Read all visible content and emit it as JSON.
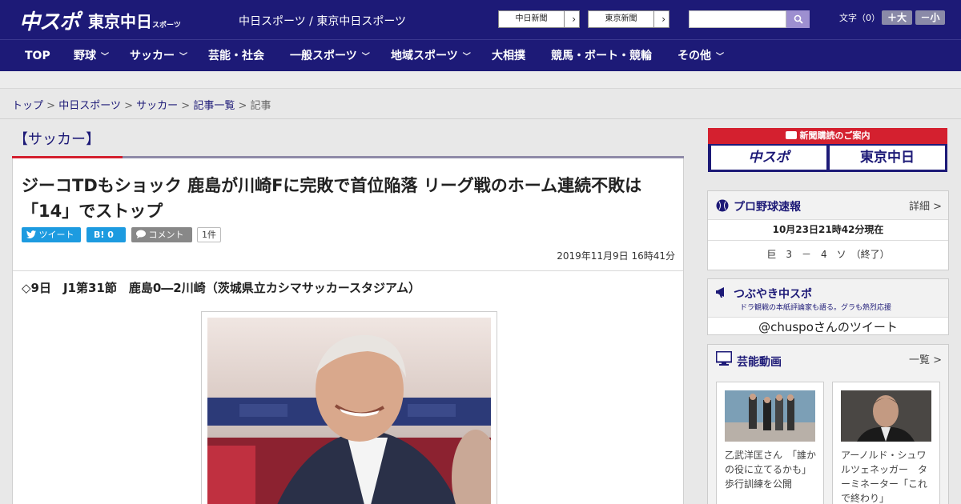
{
  "header": {
    "logo_main": "中スポ",
    "logo_sub": "東京中日",
    "logo_sub_small": "スポーツ",
    "site_links": "中日スポーツ / 東京中日スポーツ",
    "paper1": "中日新聞",
    "paper2": "東京新聞",
    "fontsize_label": "文字（0）",
    "font_up": "＋大",
    "font_down": "－小"
  },
  "nav": {
    "items": [
      "TOP",
      "野球",
      "サッカー",
      "芸能・社会",
      "一般スポーツ",
      "地域スポーツ",
      "大相撲",
      "競馬・ボート・競輪",
      "その他"
    ]
  },
  "breadcrumb": {
    "items": [
      "トップ",
      "中日スポーツ",
      "サッカー",
      "記事一覧"
    ],
    "current": "記事",
    "sep": ">"
  },
  "article": {
    "category": "【サッカー】",
    "headline": "ジーコTDもショック 鹿島が川崎Fに完敗で首位陥落 リーグ戦のホーム連続不敗は「14」でストップ",
    "tweet_label": "ツイート",
    "hatena_label": "B! 0",
    "comment_label": "コメント",
    "comment_count": "1件",
    "date": "2019年11月9日 16時41分",
    "lead": "◇9日　J1第31節　鹿島0―2川崎（茨城県立カシマサッカースタジアム）"
  },
  "sidebar": {
    "banner_title": "新聞購読のご案内",
    "banner_left": "中スポ",
    "banner_right": "東京中日",
    "baseball": {
      "title": "プロ野球速報",
      "link": "詳細 >",
      "time": "10月23日21時42分現在",
      "score": "巨　3　－　4　ソ　（終了）"
    },
    "tweets": {
      "title": "つぶやき中スポ",
      "sub": "ドラ観戦の本紙評論家も語る。グラも熱烈応援",
      "handle": "@chuspoさんのツイート"
    },
    "videos": {
      "title": "芸能動画",
      "link": "一覧 >",
      "items": [
        {
          "caption": "乙武洋匡さん　「誰かの役に立てるかも」歩行訓練を公開"
        },
        {
          "caption": "アーノルド・シュワルツェネッガー　ターミネーター「これで終わり」"
        }
      ]
    }
  }
}
